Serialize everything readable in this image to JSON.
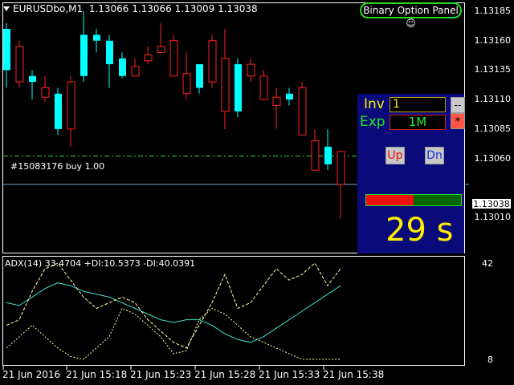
{
  "header": {
    "symbol_tf": "EURUSDbo,M1",
    "ohlc": "1.13066 1.13066 1.13009 1.13038"
  },
  "panel_button": {
    "label": "Binary Option Panel ☺",
    "color": "#22dd22"
  },
  "price_axis": [
    "1.13185",
    "1.13160",
    "1.13135",
    "1.13110",
    "1.13085",
    "1.13060",
    "1.13010"
  ],
  "current_price": "1.13038",
  "order_label": "#15083176 buy 1.00",
  "bo_panel": {
    "inv_label": "Inv",
    "inv_value": "1",
    "exp_label": "Exp",
    "exp_value": "1M",
    "minus_btn": "--",
    "star_btn": "*",
    "up_btn": "Up",
    "dn_btn": "Dn",
    "progress": 0.5,
    "timer": "29 s"
  },
  "indicator": {
    "title": "ADX(14) 33.4704 +DI:10.5373 -DI:40.0391",
    "level_top": "42",
    "level_bottom": "8"
  },
  "time_axis": [
    "21 Jun 2016",
    "21 Jun 15:18",
    "21 Jun 15:23",
    "21 Jun 15:28",
    "21 Jun 15:33",
    "21 Jun 15:38"
  ],
  "colors": {
    "bull": "#00ffff",
    "bear": "#ff2222",
    "adx": "#40e0d0",
    "di": "#ffffaa",
    "panel": "#0a0a7a"
  },
  "chart_data": {
    "type": "candlestick",
    "candles": [
      {
        "o": 1.13135,
        "h": 1.13175,
        "l": 1.1312,
        "c": 1.1317
      },
      {
        "o": 1.13155,
        "h": 1.1316,
        "l": 1.1312,
        "c": 1.13125
      },
      {
        "o": 1.13125,
        "h": 1.13135,
        "l": 1.1311,
        "c": 1.1313
      },
      {
        "o": 1.1312,
        "h": 1.1313,
        "l": 1.13108,
        "c": 1.13112
      },
      {
        "o": 1.13085,
        "h": 1.1312,
        "l": 1.1308,
        "c": 1.13115
      },
      {
        "o": 1.13125,
        "h": 1.1313,
        "l": 1.1307,
        "c": 1.13085
      },
      {
        "o": 1.1313,
        "h": 1.13185,
        "l": 1.13125,
        "c": 1.13165
      },
      {
        "o": 1.1316,
        "h": 1.1317,
        "l": 1.1315,
        "c": 1.13165
      },
      {
        "o": 1.1314,
        "h": 1.13165,
        "l": 1.1312,
        "c": 1.1316
      },
      {
        "o": 1.1313,
        "h": 1.1315,
        "l": 1.13128,
        "c": 1.13145
      },
      {
        "o": 1.13138,
        "h": 1.13145,
        "l": 1.1313,
        "c": 1.1313
      },
      {
        "o": 1.13148,
        "h": 1.13155,
        "l": 1.1314,
        "c": 1.13143
      },
      {
        "o": 1.13155,
        "h": 1.13175,
        "l": 1.1315,
        "c": 1.1315
      },
      {
        "o": 1.1316,
        "h": 1.13165,
        "l": 1.1313,
        "c": 1.1313
      },
      {
        "o": 1.13132,
        "h": 1.1315,
        "l": 1.1311,
        "c": 1.13115
      },
      {
        "o": 1.1312,
        "h": 1.1314,
        "l": 1.13115,
        "c": 1.1314
      },
      {
        "o": 1.1316,
        "h": 1.13165,
        "l": 1.1312,
        "c": 1.13125
      },
      {
        "o": 1.13145,
        "h": 1.1317,
        "l": 1.13085,
        "c": 1.131
      },
      {
        "o": 1.131,
        "h": 1.13145,
        "l": 1.13095,
        "c": 1.1314
      },
      {
        "o": 1.1314,
        "h": 1.13145,
        "l": 1.13125,
        "c": 1.1313
      },
      {
        "o": 1.1313,
        "h": 1.13135,
        "l": 1.13115,
        "c": 1.1311
      },
      {
        "o": 1.13112,
        "h": 1.1312,
        "l": 1.13085,
        "c": 1.13105
      },
      {
        "o": 1.1311,
        "h": 1.1312,
        "l": 1.13105,
        "c": 1.13115
      },
      {
        "o": 1.1312,
        "h": 1.13125,
        "l": 1.1308,
        "c": 1.1308
      },
      {
        "o": 1.13075,
        "h": 1.13085,
        "l": 1.1305,
        "c": 1.1305
      },
      {
        "o": 1.13055,
        "h": 1.13085,
        "l": 1.1305,
        "c": 1.1307
      },
      {
        "o": 1.13066,
        "h": 1.13066,
        "l": 1.13009,
        "c": 1.13038
      }
    ],
    "order_price": 1.13062,
    "ymin": 1.13,
    "ymax": 1.132,
    "adx": [
      28,
      27,
      30,
      33,
      35,
      34,
      32,
      31,
      30,
      28,
      26,
      24,
      22,
      21,
      22,
      22,
      20,
      17,
      15,
      14,
      16,
      19,
      22,
      25,
      28,
      31,
      34
    ],
    "plus_di": [
      20,
      22,
      32,
      40,
      42,
      36,
      30,
      26,
      28,
      30,
      28,
      22,
      18,
      14,
      12,
      20,
      28,
      38,
      26,
      28,
      34,
      40,
      36,
      38,
      42,
      34,
      40
    ],
    "minus_di": [
      12,
      16,
      20,
      16,
      12,
      9,
      8,
      12,
      16,
      26,
      24,
      20,
      16,
      10,
      11,
      22,
      26,
      24,
      20,
      16,
      14,
      12,
      10,
      8,
      8,
      8,
      8
    ]
  }
}
